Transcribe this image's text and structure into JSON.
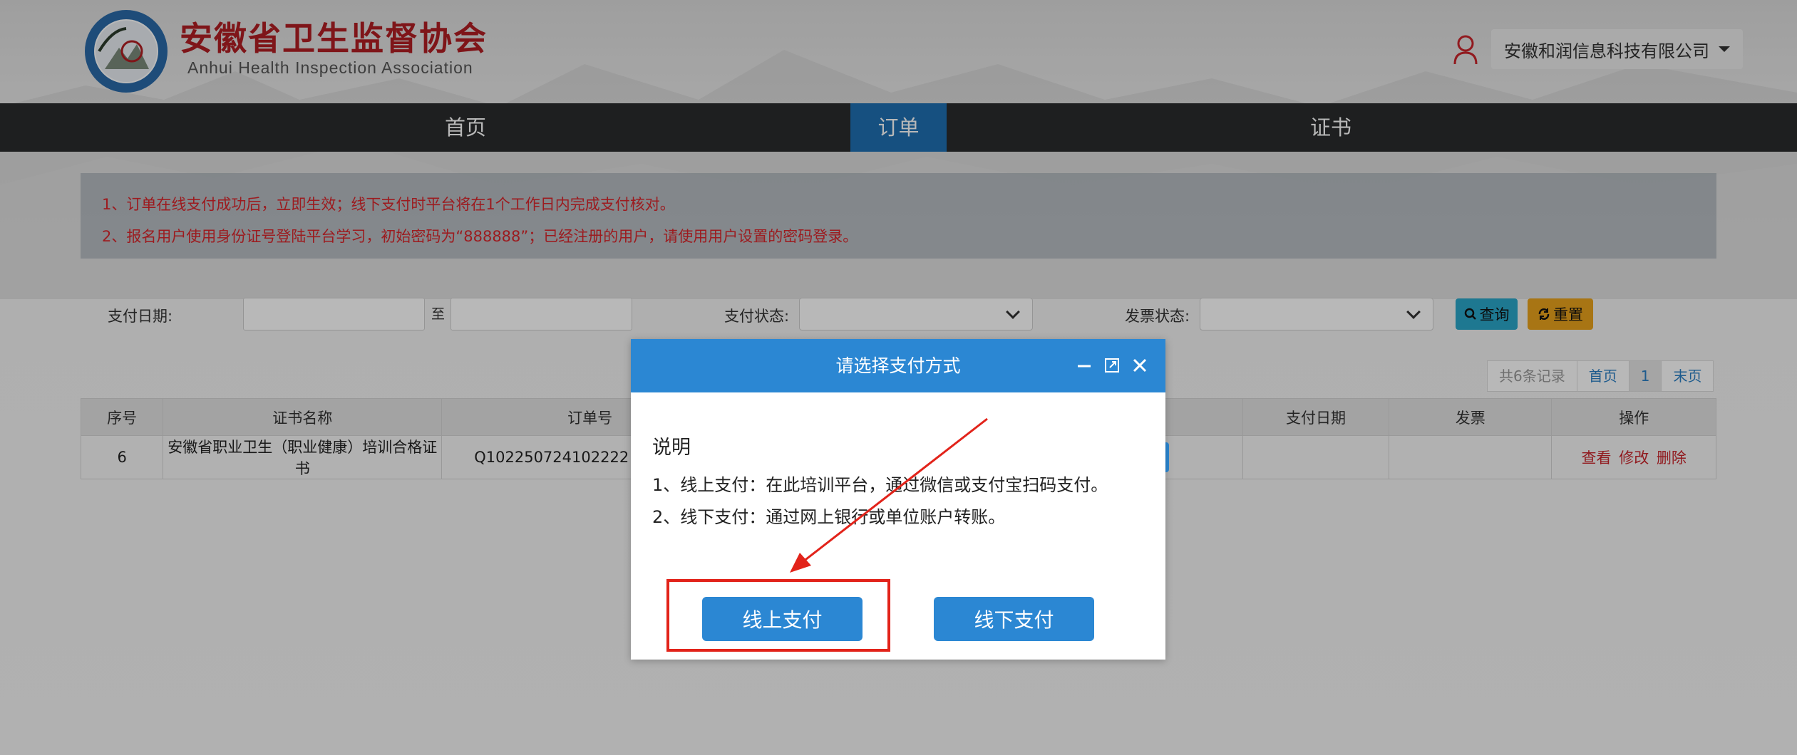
{
  "header": {
    "title": "安徽省卫生监督协会",
    "subtitle": "Anhui  Health  Inspection  Association",
    "company": "安徽和润信息科技有限公司"
  },
  "nav": {
    "home": "首页",
    "orders": "订单",
    "certificates": "证书"
  },
  "notice": {
    "line1": "1、订单在线支付成功后，立即生效；线下支付时平台将在1个工作日内完成支付核对。",
    "line2": "2、报名用户使用身份证号登陆平台学习，初始密码为“888888”；已经注册的用户，请使用用户设置的密码登录。"
  },
  "filters": {
    "pay_date_label": "支付日期:",
    "to_label": "至",
    "pay_status_label": "支付状态:",
    "invoice_status_label": "发票状态:",
    "query_label": "查询",
    "reset_label": "重置"
  },
  "pager": {
    "total": "共6条记录",
    "first": "首页",
    "current": "1",
    "last": "末页"
  },
  "table": {
    "headers": [
      "序号",
      "证书名称",
      "订单号",
      "支付日期",
      "发票",
      "操作"
    ],
    "rows": [
      {
        "index": "6",
        "cert_name": "安徽省职业卫生（职业健康）培训合格证书",
        "order_no": "Q102250724102222",
        "pay_date": "",
        "invoice": "",
        "ops": [
          "查看",
          "修改",
          "删除"
        ]
      }
    ]
  },
  "modal": {
    "title": "请选择支付方式",
    "heading": "说明",
    "line1": "1、线上支付：在此培训平台，通过微信或支付宝扫码支付。",
    "line2": "2、线下支付：通过网上银行或单位账户转账。",
    "online_label": "线上支付",
    "offline_label": "线下支付"
  },
  "colors": {
    "brand_red": "#b01e23",
    "nav_active": "#1f6fb2",
    "modal_blue": "#2b87d3",
    "notice_red": "#d8262c",
    "highlight_red": "#e2231a"
  }
}
